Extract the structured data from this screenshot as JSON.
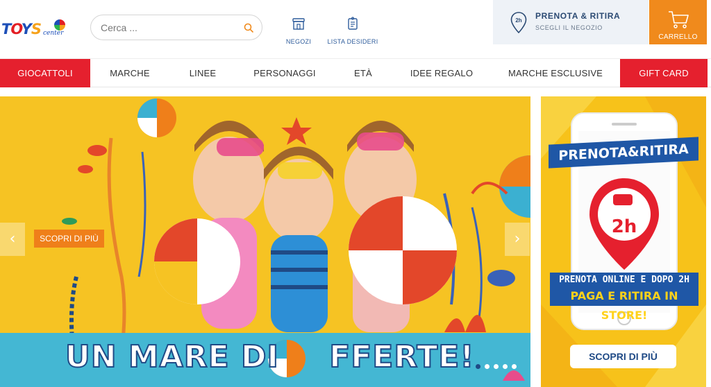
{
  "header": {
    "logo": {
      "main": [
        "T",
        "O",
        "Y",
        "S"
      ],
      "sub": "center"
    },
    "search": {
      "placeholder": "Cerca ...",
      "icon": "search-icon"
    },
    "nav": [
      {
        "label": "NEGOZI",
        "icon": "store-icon"
      },
      {
        "label": "LISTA DESIDERI",
        "icon": "wishlist-icon"
      }
    ],
    "pickup": {
      "badge": "2h",
      "title": "PRENOTA & RITIRA",
      "subtitle": "SCEGLI IL NEGOZIO",
      "icon": "location-pin-icon"
    },
    "cart": {
      "label": "CARRELLO",
      "icon": "cart-icon"
    }
  },
  "menu": [
    {
      "label": "GIOCATTOLI",
      "highlight": true
    },
    {
      "label": "MARCHE",
      "highlight": false
    },
    {
      "label": "LINEE",
      "highlight": false
    },
    {
      "label": "PERSONAGGI",
      "highlight": false
    },
    {
      "label": "ETÀ",
      "highlight": false
    },
    {
      "label": "IDEE REGALO",
      "highlight": false
    },
    {
      "label": "MARCHE ESCLUSIVE",
      "highlight": false
    },
    {
      "label": "GIFT CARD",
      "highlight": true
    }
  ],
  "hero": {
    "cta": "SCOPRI DI PIÙ",
    "banner": "UN MARE DI ",
    "banner_end": "FFERTE!",
    "prev": "‹",
    "next": "›",
    "slides": 5,
    "active_slide": 1
  },
  "side": {
    "title": "PRENOTA&RITIRA",
    "badge": "2h",
    "line1": "PRENOTA ONLINE E DOPO 2H",
    "line2": "PAGA E RITIRA IN STORE!",
    "cta": "SCOPRI DI PIÙ"
  },
  "colors": {
    "red": "#e5202e",
    "orange": "#f08a1c",
    "blue": "#1f4a86",
    "yellow": "#f6c323"
  }
}
